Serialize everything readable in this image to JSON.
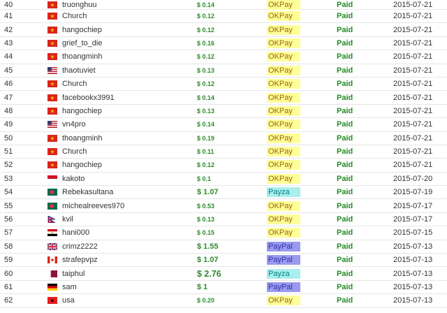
{
  "payouts": [
    {
      "num": "40",
      "flag": "vietnam-flag-icon",
      "user": "truonghuu",
      "amount": "$ 0.14",
      "size": "small",
      "processor": "OKPay",
      "status": "Paid",
      "date": "2015-07-21"
    },
    {
      "num": "41",
      "flag": "vietnam-flag-icon",
      "user": "Church",
      "amount": "$ 0.12",
      "size": "small",
      "processor": "OKPay",
      "status": "Paid",
      "date": "2015-07-21"
    },
    {
      "num": "42",
      "flag": "vietnam-flag-icon",
      "user": "hangochiep",
      "amount": "$ 0.12",
      "size": "small",
      "processor": "OKPay",
      "status": "Paid",
      "date": "2015-07-21"
    },
    {
      "num": "43",
      "flag": "vietnam-flag-icon",
      "user": "grief_to_die",
      "amount": "$ 0.16",
      "size": "small",
      "processor": "OKPay",
      "status": "Paid",
      "date": "2015-07-21"
    },
    {
      "num": "44",
      "flag": "vietnam-flag-icon",
      "user": "thoangminh",
      "amount": "$ 0.12",
      "size": "small",
      "processor": "OKPay",
      "status": "Paid",
      "date": "2015-07-21"
    },
    {
      "num": "45",
      "flag": "usa-flag-icon",
      "user": "thaotuviet",
      "amount": "$ 0.13",
      "size": "small",
      "processor": "OKPay",
      "status": "Paid",
      "date": "2015-07-21"
    },
    {
      "num": "46",
      "flag": "vietnam-flag-icon",
      "user": "Church",
      "amount": "$ 0.12",
      "size": "small",
      "processor": "OKPay",
      "status": "Paid",
      "date": "2015-07-21"
    },
    {
      "num": "47",
      "flag": "vietnam-flag-icon",
      "user": "facebookx3991",
      "amount": "$ 0.14",
      "size": "small",
      "processor": "OKPay",
      "status": "Paid",
      "date": "2015-07-21"
    },
    {
      "num": "48",
      "flag": "vietnam-flag-icon",
      "user": "hangochiep",
      "amount": "$ 0.13",
      "size": "small",
      "processor": "OKPay",
      "status": "Paid",
      "date": "2015-07-21"
    },
    {
      "num": "49",
      "flag": "usa-flag-icon",
      "user": "vn4pro",
      "amount": "$ 0.14",
      "size": "small",
      "processor": "OKPay",
      "status": "Paid",
      "date": "2015-07-21"
    },
    {
      "num": "50",
      "flag": "vietnam-flag-icon",
      "user": "thoangminh",
      "amount": "$ 0.19",
      "size": "small",
      "processor": "OKPay",
      "status": "Paid",
      "date": "2015-07-21"
    },
    {
      "num": "51",
      "flag": "vietnam-flag-icon",
      "user": "Church",
      "amount": "$ 0.11",
      "size": "small",
      "processor": "OKPay",
      "status": "Paid",
      "date": "2015-07-21"
    },
    {
      "num": "52",
      "flag": "vietnam-flag-icon",
      "user": "hangochiep",
      "amount": "$ 0.12",
      "size": "small",
      "processor": "OKPay",
      "status": "Paid",
      "date": "2015-07-21"
    },
    {
      "num": "53",
      "flag": "indonesia-flag-icon",
      "user": "kakoto",
      "amount": "$ 0.1",
      "size": "small",
      "processor": "OKPay",
      "status": "Paid",
      "date": "2015-07-20"
    },
    {
      "num": "54",
      "flag": "bangladesh-flag-icon",
      "user": "Rebekasultana",
      "amount": "$ 1.07",
      "size": "big",
      "processor": "Payza",
      "status": "Paid",
      "date": "2015-07-19"
    },
    {
      "num": "55",
      "flag": "bangladesh-flag-icon",
      "user": "michealreeves970",
      "amount": "$ 0.53",
      "size": "small",
      "processor": "OKPay",
      "status": "Paid",
      "date": "2015-07-17"
    },
    {
      "num": "56",
      "flag": "nepal-flag-icon",
      "user": "kvil",
      "amount": "$ 0.13",
      "size": "small",
      "processor": "OKPay",
      "status": "Paid",
      "date": "2015-07-17"
    },
    {
      "num": "57",
      "flag": "egypt-flag-icon",
      "user": "hani000",
      "amount": "$ 0.15",
      "size": "small",
      "processor": "OKPay",
      "status": "Paid",
      "date": "2015-07-15"
    },
    {
      "num": "58",
      "flag": "uk-flag-icon",
      "user": "crimz2222",
      "amount": "$ 1.55",
      "size": "big",
      "processor": "PayPal",
      "status": "Paid",
      "date": "2015-07-13"
    },
    {
      "num": "59",
      "flag": "canada-flag-icon",
      "user": "strafepvpz",
      "amount": "$ 1.07",
      "size": "big",
      "processor": "PayPal",
      "status": "Paid",
      "date": "2015-07-13"
    },
    {
      "num": "60",
      "flag": "qatar-flag-icon",
      "user": "taiphul",
      "amount": "$ 2.76",
      "size": "huge",
      "processor": "Payza",
      "status": "Paid",
      "date": "2015-07-13"
    },
    {
      "num": "61",
      "flag": "germany-flag-icon",
      "user": "sam",
      "amount": "$ 1",
      "size": "big",
      "processor": "PayPal",
      "status": "Paid",
      "date": "2015-07-13"
    },
    {
      "num": "62",
      "flag": "albania-flag-icon",
      "user": "usa",
      "amount": "$ 0.20",
      "size": "small",
      "processor": "OKPay",
      "status": "Paid",
      "date": "2015-07-13"
    }
  ]
}
